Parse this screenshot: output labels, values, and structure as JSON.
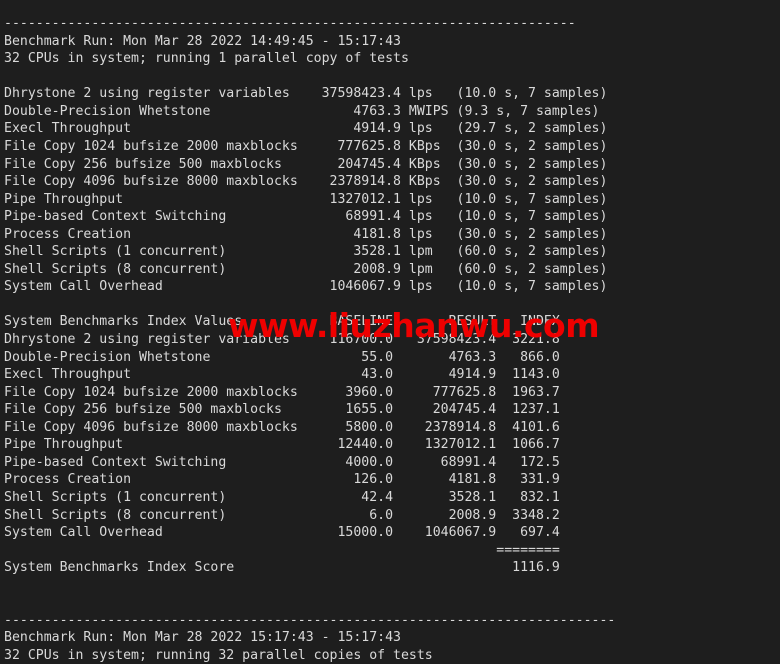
{
  "terminal": {
    "background_color": "#1e1e1e",
    "text_color": "#d9d9d9",
    "watermark": {
      "text": "www.liuzhanwu.com",
      "color": "#ee0000"
    },
    "separator_dashes_top": "------------------------------------------------------------------------",
    "separator_dashes_bottom": "-----------------------------------------------------------------------------",
    "separator_equals": "========",
    "run1": {
      "header": "Benchmark Run: Mon Mar 28 2022 14:49:45 - 15:17:43",
      "cpus": "32 CPUs in system; running 1 parallel copy of tests"
    },
    "run2": {
      "header": "Benchmark Run: Mon Mar 28 2022 15:17:43 - 15:17:43",
      "cpus": "32 CPUs in system; running 32 parallel copies of tests"
    },
    "results": [
      {
        "name": "Dhrystone 2 using register variables",
        "value": "37598423.4",
        "unit": "lps",
        "timing": "(10.0 s, 7 samples)"
      },
      {
        "name": "Double-Precision Whetstone",
        "value": "4763.3",
        "unit": "MWIPS",
        "timing": "(9.3 s, 7 samples)"
      },
      {
        "name": "Execl Throughput",
        "value": "4914.9",
        "unit": "lps",
        "timing": "(29.7 s, 2 samples)"
      },
      {
        "name": "File Copy 1024 bufsize 2000 maxblocks",
        "value": "777625.8",
        "unit": "KBps",
        "timing": "(30.0 s, 2 samples)"
      },
      {
        "name": "File Copy 256 bufsize 500 maxblocks",
        "value": "204745.4",
        "unit": "KBps",
        "timing": "(30.0 s, 2 samples)"
      },
      {
        "name": "File Copy 4096 bufsize 8000 maxblocks",
        "value": "2378914.8",
        "unit": "KBps",
        "timing": "(30.0 s, 2 samples)"
      },
      {
        "name": "Pipe Throughput",
        "value": "1327012.1",
        "unit": "lps",
        "timing": "(10.0 s, 7 samples)"
      },
      {
        "name": "Pipe-based Context Switching",
        "value": "68991.4",
        "unit": "lps",
        "timing": "(10.0 s, 7 samples)"
      },
      {
        "name": "Process Creation",
        "value": "4181.8",
        "unit": "lps",
        "timing": "(30.0 s, 2 samples)"
      },
      {
        "name": "Shell Scripts (1 concurrent)",
        "value": "3528.1",
        "unit": "lpm",
        "timing": "(60.0 s, 2 samples)"
      },
      {
        "name": "Shell Scripts (8 concurrent)",
        "value": "2008.9",
        "unit": "lpm",
        "timing": "(60.0 s, 2 samples)"
      },
      {
        "name": "System Call Overhead",
        "value": "1046067.9",
        "unit": "lps",
        "timing": "(10.0 s, 7 samples)"
      }
    ],
    "index_table": {
      "title": "System Benchmarks Index Values",
      "columns": [
        "BASELINE",
        "RESULT",
        "INDEX"
      ],
      "rows": [
        {
          "name": "Dhrystone 2 using register variables",
          "baseline": "116700.0",
          "result": "37598423.4",
          "index": "3221.8"
        },
        {
          "name": "Double-Precision Whetstone",
          "baseline": "55.0",
          "result": "4763.3",
          "index": "866.0"
        },
        {
          "name": "Execl Throughput",
          "baseline": "43.0",
          "result": "4914.9",
          "index": "1143.0"
        },
        {
          "name": "File Copy 1024 bufsize 2000 maxblocks",
          "baseline": "3960.0",
          "result": "777625.8",
          "index": "1963.7"
        },
        {
          "name": "File Copy 256 bufsize 500 maxblocks",
          "baseline": "1655.0",
          "result": "204745.4",
          "index": "1237.1"
        },
        {
          "name": "File Copy 4096 bufsize 8000 maxblocks",
          "baseline": "5800.0",
          "result": "2378914.8",
          "index": "4101.6"
        },
        {
          "name": "Pipe Throughput",
          "baseline": "12440.0",
          "result": "1327012.1",
          "index": "1066.7"
        },
        {
          "name": "Pipe-based Context Switching",
          "baseline": "4000.0",
          "result": "68991.4",
          "index": "172.5"
        },
        {
          "name": "Process Creation",
          "baseline": "126.0",
          "result": "4181.8",
          "index": "331.9"
        },
        {
          "name": "Shell Scripts (1 concurrent)",
          "baseline": "42.4",
          "result": "3528.1",
          "index": "832.1"
        },
        {
          "name": "Shell Scripts (8 concurrent)",
          "baseline": "6.0",
          "result": "2008.9",
          "index": "3348.2"
        },
        {
          "name": "System Call Overhead",
          "baseline": "15000.0",
          "result": "1046067.9",
          "index": "697.4"
        }
      ],
      "score_label": "System Benchmarks Index Score",
      "score_value": "1116.9"
    }
  }
}
